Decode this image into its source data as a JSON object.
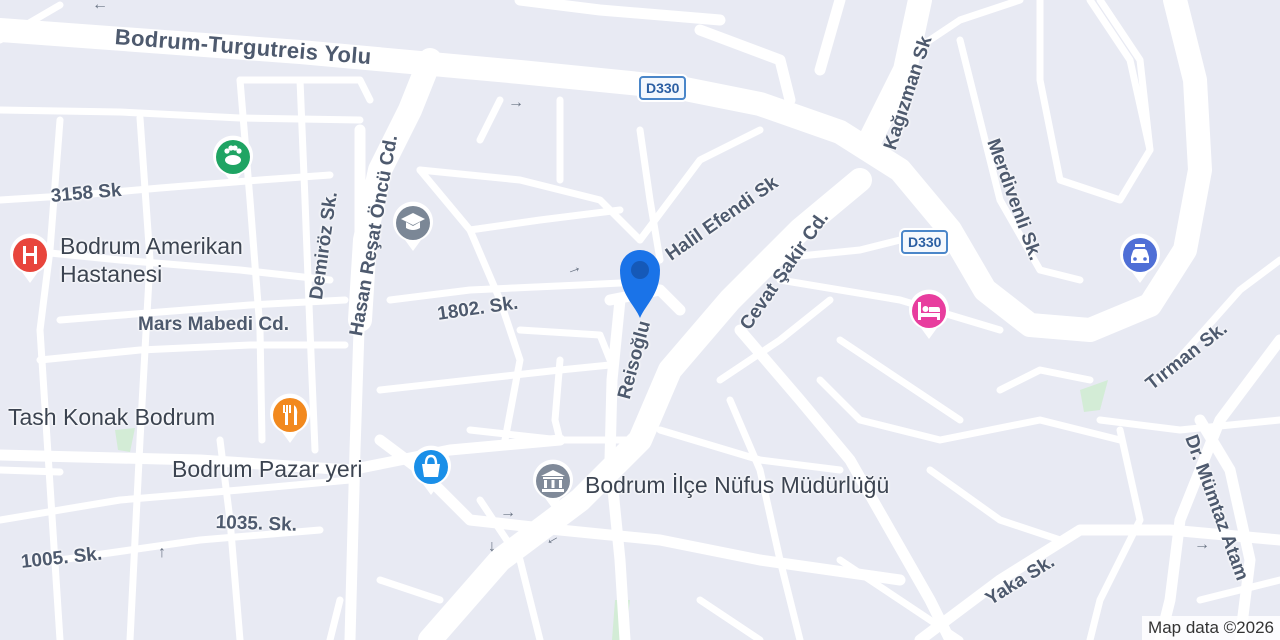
{
  "map": {
    "streets": {
      "bodrum_turgutreis_yolu": "Bodrum-Turgutreis Yolu",
      "hasan_resat_oncu": "Hasan Reşat Öncü Cd.",
      "kagizman": "Kağızman Sk",
      "cevat_sakir": "Cevat Şakir Cd.",
      "halil_efendi": "Halil Efendi Sk",
      "reisoglu": "Reisoğlu",
      "merdivenli": "Merdivenli Sk.",
      "sk_3158": "3158 Sk",
      "demiroz": "Demiröz Sk.",
      "sk_1802": "1802. Sk.",
      "mars_mabedi": "Mars Mabedi Cd.",
      "tirman": "Tırman Sk.",
      "sk_1035": "1035. Sk.",
      "sk_1005": "1005. Sk.",
      "yaka": "Yaka Sk.",
      "dr_mumtaz": "Dr. Mümtaz Atam"
    },
    "route_shields": [
      "D330",
      "D330"
    ],
    "pois": {
      "hospital": "Bodrum Amerikan Hastanesi",
      "restaurant": "Tash Konak Bodrum",
      "market": "Bodrum Pazar yeri",
      "registry": "Bodrum İlçe Nüfus Müdürlüğü"
    },
    "icons": {
      "hospital": "hospital-icon",
      "restaurant": "restaurant-icon",
      "market": "shopping-bag-icon",
      "registry": "government-building-icon",
      "school": "school-icon",
      "vet": "pet-icon",
      "hotel": "hotel-bed-icon",
      "car_service": "car-service-icon",
      "location_pin": "location-pin-icon"
    },
    "colors": {
      "background": "#e8eaf3",
      "road": "#ffffff",
      "hospital": "#e8453c",
      "restaurant": "#f2891e",
      "market": "#1a8fe8",
      "registry": "#808a99",
      "school": "#7b8796",
      "vet": "#1fa463",
      "hotel": "#e83d9e",
      "car_service": "#4f6fd6",
      "pin": "#1a73e8",
      "shield_border": "#4a86c9"
    },
    "attribution": "Map data ©2026"
  }
}
